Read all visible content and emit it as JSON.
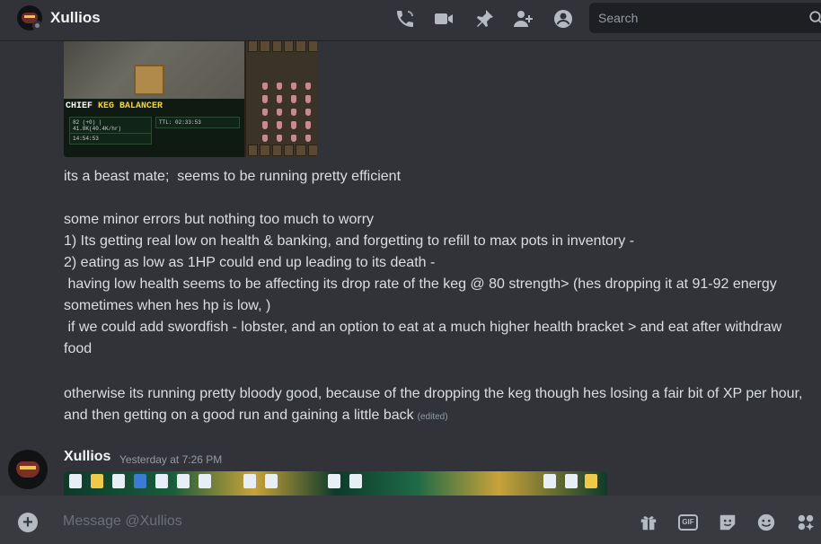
{
  "header": {
    "title": "Xullios",
    "search_placeholder": "Search"
  },
  "attachment1": {
    "panel_title_part1": "CHIEF",
    "panel_title_part2": "KEG BALANCER",
    "row1": "82 (+0) | 41.8K(40.4K/hr)",
    "row2": "TTL: 02:33:53",
    "row3": "14:54:53"
  },
  "message1": {
    "line1": "its a beast mate;  seems to be running pretty efficient",
    "para2": "some minor errors but nothing too much to worry\n1) Its getting real low on health & banking, and forgetting to refill to max pots in inventory -\n2) eating as low as 1HP could end up leading to its death -\n having low health seems to be affecting its drop rate of the keg @ 80 strength> (hes dropping it at 91-92 energy sometimes when hes hp is low, )\n if we could add swordfish - lobster, and an option to eat at a much higher health bracket > and eat after withdraw food",
    "para3": "otherwise its running pretty bloody good, because of the dropping the keg though hes losing a fair bit of XP per hour, and then getting on a good run and gaining a little back",
    "edited": "(edited)"
  },
  "message2": {
    "author": "Xullios",
    "timestamp": "Yesterday at 7:26 PM"
  },
  "composer": {
    "placeholder": "Message @Xullios",
    "gif_label": "GIF"
  }
}
